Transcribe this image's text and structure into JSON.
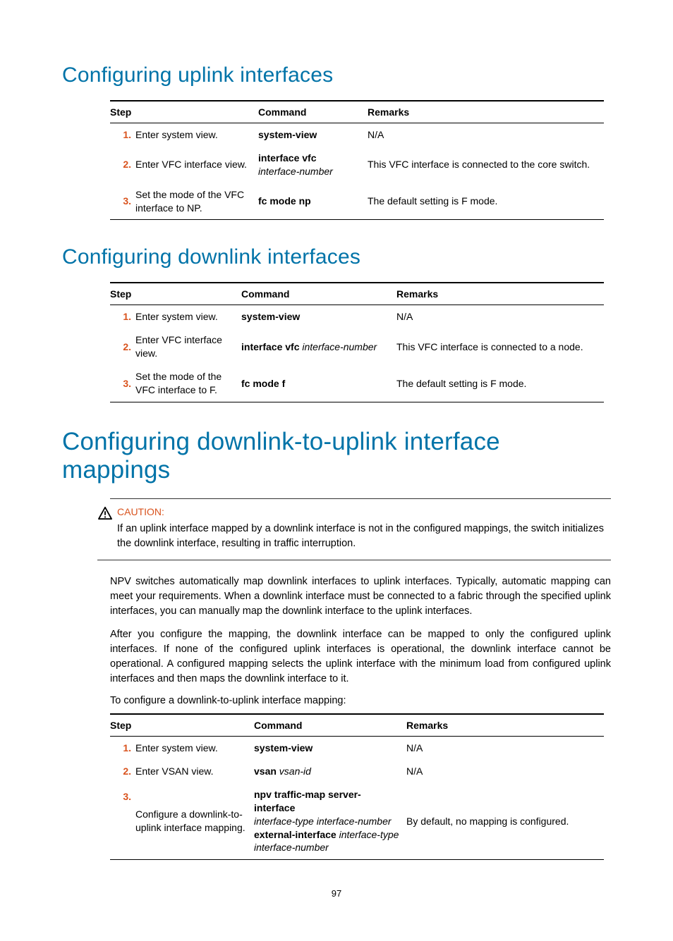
{
  "headings": {
    "uplink": "Configuring uplink interfaces",
    "downlink": "Configuring downlink interfaces",
    "mapping": "Configuring downlink-to-uplink interface mappings"
  },
  "tables": {
    "headers": {
      "step": "Step",
      "command": "Command",
      "remarks": "Remarks"
    },
    "uplink": [
      {
        "num": "1.",
        "step": "Enter system view.",
        "cmd_bold1": "system-view",
        "cmd_ital1": "",
        "cmd_bold2": "",
        "cmd_ital2": "",
        "remark": "N/A"
      },
      {
        "num": "2.",
        "step": "Enter VFC interface view.",
        "cmd_bold1": "interface vfc",
        "cmd_ital1": "interface-number",
        "cmd_bold2": "",
        "cmd_ital2": "",
        "remark": "This VFC interface is connected to the core switch."
      },
      {
        "num": "3.",
        "step": "Set the mode of the VFC interface to NP.",
        "cmd_bold1": "fc mode np",
        "cmd_ital1": "",
        "cmd_bold2": "",
        "cmd_ital2": "",
        "remark": "The default setting is F mode."
      }
    ],
    "downlink": [
      {
        "num": "1.",
        "step": "Enter system view.",
        "cmd_bold1": "system-view",
        "cmd_ital1": "",
        "cmd_bold2": "",
        "cmd_ital2": "",
        "remark": "N/A"
      },
      {
        "num": "2.",
        "step": "Enter VFC interface view.",
        "cmd_bold1": "interface vfc",
        "cmd_ital1": " interface-number",
        "cmd_bold2": "",
        "cmd_ital2": "",
        "remark": "This VFC interface is connected to a node."
      },
      {
        "num": "3.",
        "step": "Set the mode of the VFC interface to F.",
        "cmd_bold1": "fc mode f",
        "cmd_ital1": "",
        "cmd_bold2": "",
        "cmd_ital2": "",
        "remark": "The default setting is F mode."
      }
    ],
    "mapping": [
      {
        "num": "1.",
        "step": "Enter system view.",
        "cmd_bold1": "system-view",
        "cmd_ital1": "",
        "cmd_bold2": "",
        "cmd_ital2": "",
        "remark": "N/A"
      },
      {
        "num": "2.",
        "step": "Enter VSAN view.",
        "cmd_bold1": "vsan",
        "cmd_ital1": " vsan-id",
        "cmd_bold2": "",
        "cmd_ital2": "",
        "remark": "N/A"
      },
      {
        "num": "3.",
        "step": "Configure a downlink-to-uplink interface mapping.",
        "cmd_bold1": "npv traffic-map server-interface",
        "cmd_ital1": "interface-type interface-number",
        "cmd_bold2": "external-interface",
        "cmd_ital2": " interface-type interface-number",
        "remark": "By default, no mapping is configured."
      }
    ]
  },
  "caution": {
    "title": "CAUTION:",
    "text": "If an uplink interface mapped by a downlink interface is not in the configured mappings, the switch initializes the downlink interface, resulting in traffic interruption."
  },
  "paragraphs": {
    "p1": "NPV switches automatically map downlink interfaces to uplink interfaces. Typically, automatic mapping can meet your requirements. When a downlink interface must be connected to a fabric through the specified uplink interfaces, you can manually map the downlink interface to the uplink interfaces.",
    "p2": "After you configure the mapping, the downlink interface can be mapped to only the configured uplink interfaces. If none of the configured uplink interfaces is operational, the downlink interface cannot be operational. A configured mapping selects the uplink interface with the minimum load from configured uplink interfaces and then maps the downlink interface to it.",
    "lead": "To configure a downlink-to-uplink interface mapping:"
  },
  "pagenum": "97"
}
